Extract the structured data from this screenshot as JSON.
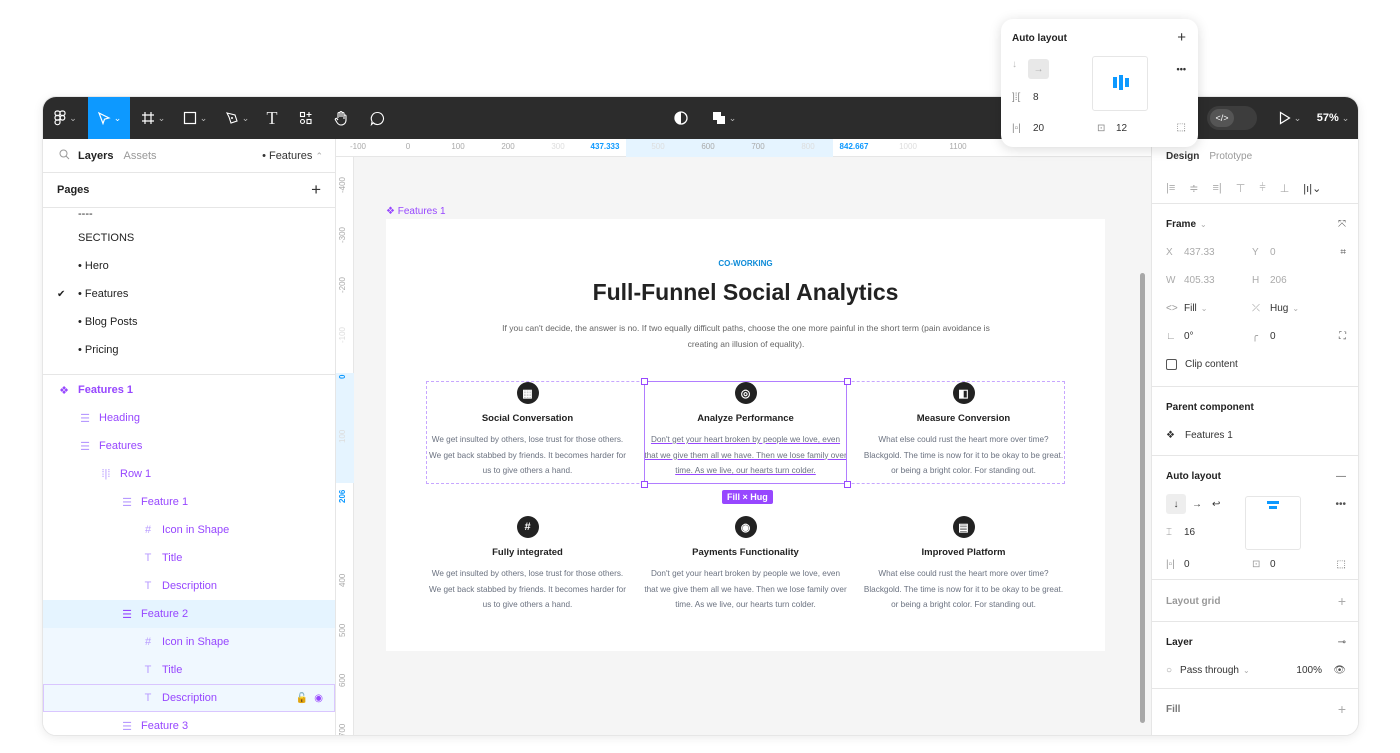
{
  "toolbar": {
    "tools": [
      {
        "name": "main-menu",
        "icon": "figma-logo-icon"
      },
      {
        "name": "move",
        "icon": "cursor-icon",
        "active": true
      },
      {
        "name": "frame",
        "icon": "frame-hash-icon"
      },
      {
        "name": "shape",
        "icon": "square-icon"
      },
      {
        "name": "pen",
        "icon": "pen-icon"
      },
      {
        "name": "text",
        "icon": "text-icon",
        "glyph": "T"
      },
      {
        "name": "resources",
        "icon": "resources-icon"
      },
      {
        "name": "hand",
        "icon": "hand-icon"
      },
      {
        "name": "comment",
        "icon": "comment-icon"
      }
    ],
    "center": [
      {
        "name": "contrast",
        "icon": "contrast-icon"
      },
      {
        "name": "boolean",
        "icon": "component-union-icon"
      }
    ],
    "dev_mode_icon": "</>",
    "zoom": "57%",
    "accent": "#0d99ff"
  },
  "left_panel": {
    "tabs": {
      "layers": "Layers",
      "assets": "Assets"
    },
    "current_page": "• Features",
    "pages_title": "Pages",
    "add_icon": "+",
    "pages": [
      {
        "label": "----",
        "checked": false
      },
      {
        "label": "SECTIONS",
        "checked": false
      },
      {
        "label": "• Hero",
        "checked": false
      },
      {
        "label": "• Features",
        "checked": true
      },
      {
        "label": "• Blog Posts",
        "checked": false
      },
      {
        "label": "• Pricing",
        "checked": false
      }
    ],
    "layers": [
      {
        "label": "Features 1",
        "icon": "component-icon",
        "glyph": "❖",
        "depth": 0,
        "state": "",
        "bold": true
      },
      {
        "label": "Heading",
        "icon": "autolayout-vertical-icon",
        "glyph": "☰",
        "depth": 1,
        "state": ""
      },
      {
        "label": "Features",
        "icon": "autolayout-vertical-icon",
        "glyph": "☰",
        "depth": 1,
        "state": ""
      },
      {
        "label": "Row 1",
        "icon": "autolayout-horizontal-icon",
        "glyph": "⁞|⁞",
        "depth": 2,
        "state": ""
      },
      {
        "label": "Feature 1",
        "icon": "autolayout-vertical-icon",
        "glyph": "☰",
        "depth": 3,
        "state": ""
      },
      {
        "label": "Icon in Shape",
        "icon": "frame-icon",
        "glyph": "#",
        "depth": 4,
        "state": ""
      },
      {
        "label": "Title",
        "icon": "text-icon",
        "glyph": "T",
        "depth": 4,
        "state": ""
      },
      {
        "label": "Description",
        "icon": "text-icon",
        "glyph": "T",
        "depth": 4,
        "state": ""
      },
      {
        "label": "Feature 2",
        "icon": "autolayout-vertical-icon",
        "glyph": "☰",
        "depth": 3,
        "state": "selected"
      },
      {
        "label": "Icon in Shape",
        "icon": "frame-icon",
        "glyph": "#",
        "depth": 4,
        "state": "selchild"
      },
      {
        "label": "Title",
        "icon": "text-icon",
        "glyph": "T",
        "depth": 4,
        "state": "selchild"
      },
      {
        "label": "Description",
        "icon": "text-icon",
        "glyph": "T",
        "depth": 4,
        "state": "hover"
      },
      {
        "label": "Feature 3",
        "icon": "autolayout-vertical-icon",
        "glyph": "☰",
        "depth": 3,
        "state": ""
      }
    ],
    "layer_color": "#9747ff"
  },
  "rulers": {
    "top": [
      "-100",
      "0",
      "100",
      "200",
      "300",
      "437.333",
      "500",
      "600",
      "700",
      "800",
      "842.667",
      "1000",
      "1100"
    ],
    "left": [
      "-400",
      "-300",
      "-200",
      "-100",
      "0",
      "100",
      "206",
      "400",
      "500",
      "600",
      "700"
    ]
  },
  "canvas": {
    "frame_label": "❖ Features 1",
    "eyebrow": "CO-WORKING",
    "title": "Full-Funnel Social Analytics",
    "subtitle": "If you can't decide, the answer is no. If two equally difficult paths, choose the one more painful in the short term (pain avoidance is creating an illusion of equality).",
    "size_badge": "Fill × Hug",
    "features": [
      {
        "title": "Social Conversation",
        "icon": "layout-icon",
        "glyph": "▦",
        "desc": "We get insulted by others, lose trust for those others. We get back stabbed by friends. It becomes harder for us to give others a hand."
      },
      {
        "title": "Analyze Performance",
        "icon": "fingerprint-icon",
        "glyph": "◎",
        "desc": "Don't get your heart broken by people we love, even that we give them all we have. Then we lose family over time. As we live, our hearts turn colder."
      },
      {
        "title": "Measure Conversion",
        "icon": "swatch-icon",
        "glyph": "◧",
        "desc": "What else could rust the heart more over time? Blackgold. The time is now for it to be okay to be great. or being a bright color. For standing out."
      },
      {
        "title": "Fully integrated",
        "icon": "hash-icon",
        "glyph": "#",
        "desc": "We get insulted by others, lose trust for those others. We get back stabbed by friends. It becomes harder for us to give others a hand."
      },
      {
        "title": "Payments Functionality",
        "icon": "eye-icon",
        "glyph": "◉",
        "desc": "Don't get your heart broken by people we love, even that we give them all we have. Then we lose family over time. As we live, our hearts turn colder."
      },
      {
        "title": "Improved Platform",
        "icon": "document-icon",
        "glyph": "▤",
        "desc": "What else could rust the heart more over time? Blackgold. The time is now for it to be okay to be great. or being a bright color. For standing out."
      }
    ]
  },
  "popover": {
    "title": "Auto layout",
    "add": "+",
    "gap": "8",
    "padding_h": "20",
    "padding_v": "12",
    "more": "•••"
  },
  "right_panel": {
    "tabs": {
      "design": "Design",
      "prototype": "Prototype"
    },
    "frame": {
      "title": "Frame",
      "x_label": "X",
      "x": "437.33",
      "y_label": "Y",
      "y": "0",
      "w_label": "W",
      "w": "405.33",
      "h_label": "H",
      "h": "206",
      "width_mode": "Fill",
      "height_mode": "Hug",
      "rotation": "0°",
      "radius": "0",
      "clip_content": "Clip content"
    },
    "parent_component": {
      "title": "Parent component",
      "name": "Features 1"
    },
    "auto_layout": {
      "title": "Auto layout",
      "gap": "16",
      "padding_h": "0",
      "padding_v": "0",
      "more": "•••",
      "remove": "—"
    },
    "layout_grid": {
      "title": "Layout grid"
    },
    "layer": {
      "title": "Layer",
      "blend": "Pass through",
      "opacity": "100%"
    },
    "fill": {
      "title": "Fill"
    }
  }
}
